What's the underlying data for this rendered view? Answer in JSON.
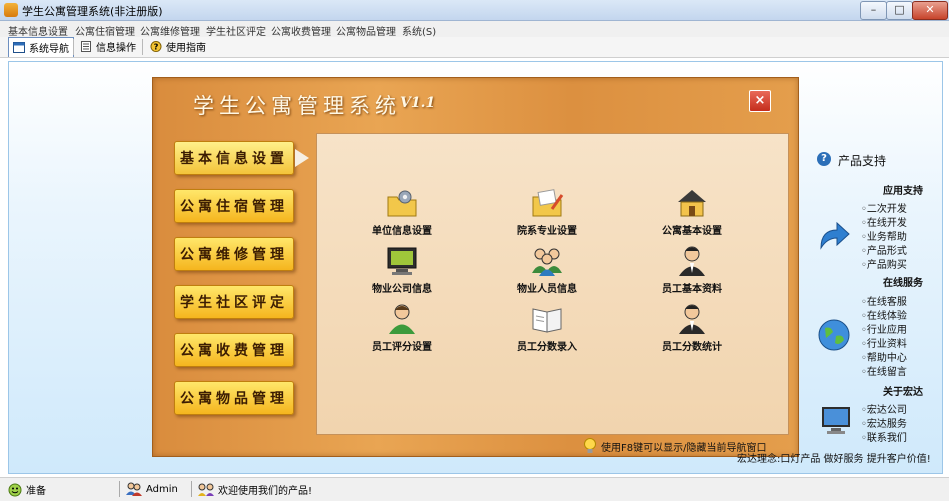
{
  "window": {
    "title": "学生公寓管理系统(非注册版)"
  },
  "menubar": {
    "items": [
      "基本信息设置",
      "公寓住宿管理",
      "公寓维修管理",
      "学生社区评定",
      "公寓收费管理",
      "公寓物品管理",
      "系统(S)"
    ]
  },
  "toolbar": {
    "items": [
      "系统导航",
      "信息操作",
      "使用指南"
    ]
  },
  "panel": {
    "title": "学生公寓管理系统",
    "version": "V1.1",
    "close_symbol": "×",
    "menu": [
      "基本信息设置",
      "公寓住宿管理",
      "公寓维修管理",
      "学生社区评定",
      "公寓收费管理",
      "公寓物品管理"
    ],
    "tiles": [
      "单位信息设置",
      "院系专业设置",
      "公寓基本设置",
      "物业公司信息",
      "物业人员信息",
      "员工基本资料",
      "员工评分设置",
      "员工分数录入",
      "员工分数统计"
    ],
    "tip": "使用F8键可以显示/隐藏当前导航窗口"
  },
  "support": {
    "title": "产品支持",
    "sections": [
      {
        "heading": "应用支持",
        "items": [
          "二次开发",
          "在线开发",
          "业务帮助",
          "产品形式",
          "产品购买"
        ]
      },
      {
        "heading": "在线服务",
        "items": [
          "在线客服",
          "在线体验",
          "行业应用",
          "行业资料",
          "帮助中心",
          "在线留言"
        ]
      },
      {
        "heading": "关于宏达",
        "items": [
          "宏达公司",
          "宏达服务",
          "联系我们"
        ]
      }
    ],
    "slogan": "宏达理念:口灯产品  做好服务  提升客户价值!"
  },
  "statusbar": {
    "ready": "准备",
    "user": "Admin",
    "welcome": "欢迎使用我们的产品!"
  }
}
